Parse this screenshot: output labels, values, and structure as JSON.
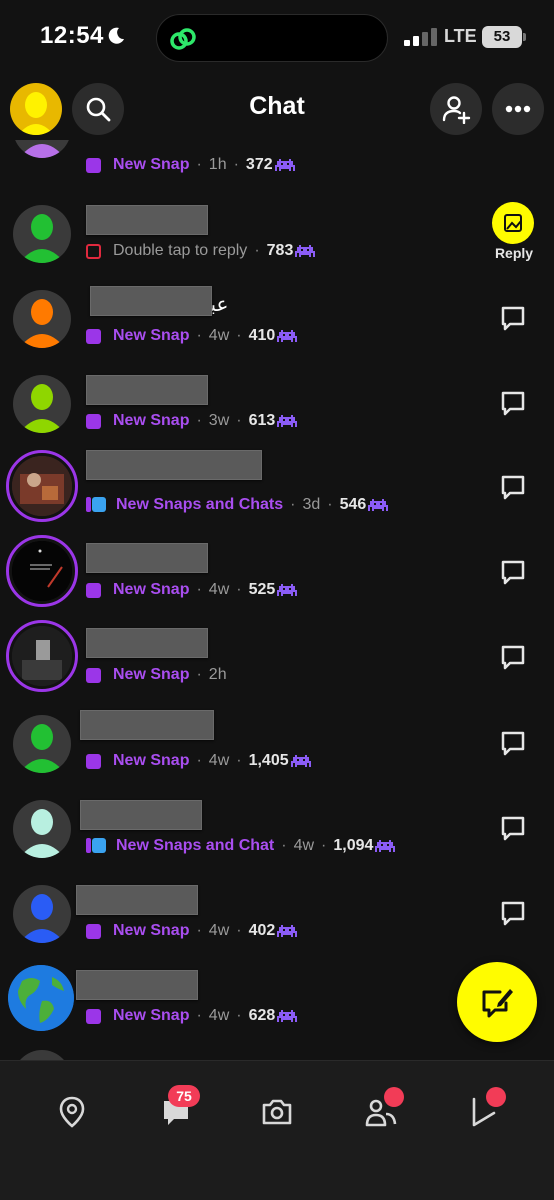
{
  "status_bar": {
    "time": "12:54",
    "network": "LTE",
    "battery": "53"
  },
  "header": {
    "title": "Chat"
  },
  "chats": [
    {
      "status": "New Snap",
      "time": "1h",
      "count": "372",
      "action": "chat"
    },
    {
      "status": "Double tap to reply",
      "time": "",
      "count": "783",
      "action": "reply",
      "reply_label": "Reply"
    },
    {
      "name_visible": "عبد",
      "status": "New Snap",
      "time": "4w",
      "count": "410",
      "action": "chat"
    },
    {
      "status": "New Snap",
      "time": "3w",
      "count": "613",
      "action": "chat"
    },
    {
      "status": "New Snaps and Chats",
      "time": "3d",
      "count": "546",
      "action": "chat"
    },
    {
      "status": "New Snap",
      "time": "4w",
      "count": "525",
      "action": "chat"
    },
    {
      "status": "New Snap",
      "time": "2h",
      "count": "",
      "action": "chat"
    },
    {
      "status": "New Snap",
      "time": "4w",
      "count": "1,405",
      "action": "chat"
    },
    {
      "status": "New Snaps and Chat",
      "time": "4w",
      "count": "1,094",
      "action": "chat"
    },
    {
      "status": "New Snap",
      "time": "4w",
      "count": "402",
      "action": "chat"
    },
    {
      "status": "New Snap",
      "time": "4w",
      "count": "628",
      "action": "chat"
    }
  ],
  "bottom_nav": {
    "chat_badge": "75"
  },
  "colors": {
    "snap_purple": "#9b36e8",
    "chat_blue": "#3aa3f0",
    "snap_yellow": "#fffc00",
    "badge_red": "#f23c57"
  }
}
